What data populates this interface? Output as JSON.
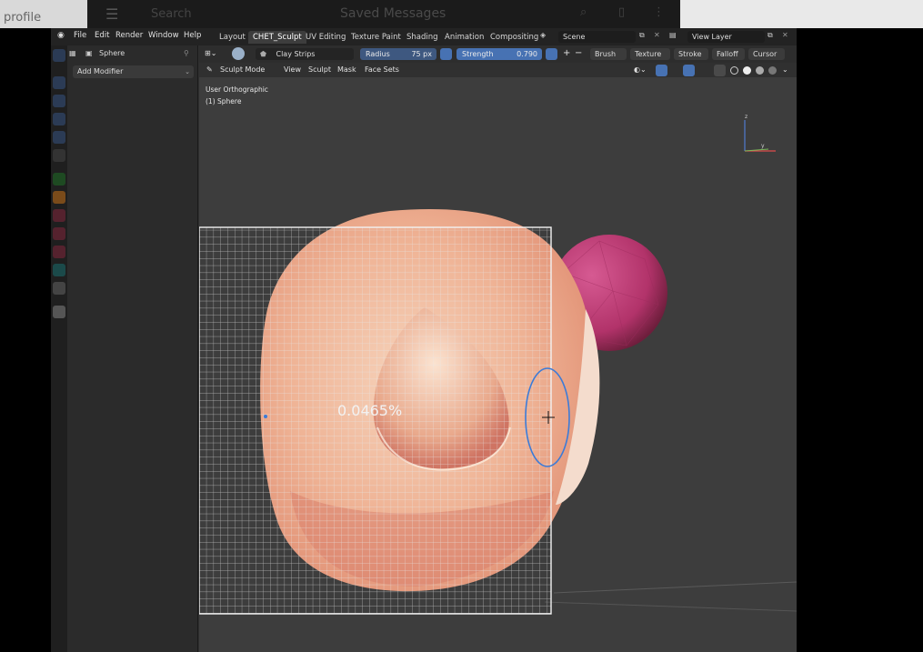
{
  "background_app": {
    "title": "Saved Messages",
    "search_label": "Search",
    "left_text": "profile"
  },
  "topbar": {
    "menus": [
      "File",
      "Edit",
      "Render",
      "Window",
      "Help"
    ],
    "workspace_tabs": [
      "Layout",
      "CHET_Sculpt",
      "UV Editing",
      "Texture Paint",
      "Shading",
      "Animation",
      "Compositing"
    ],
    "active_tab": "CHET_Sculpt",
    "scene_label": "Scene",
    "view_layer_label": "View Layer"
  },
  "properties": {
    "object_name": "Sphere",
    "add_modifier_label": "Add Modifier"
  },
  "tool_header": {
    "brush_name": "Clay Strips",
    "radius_label": "Radius",
    "radius_value": "75 px",
    "strength_label": "Strength",
    "strength_value": "0.790",
    "dropdowns": [
      "Brush",
      "Texture",
      "Stroke",
      "Falloff",
      "Cursor"
    ]
  },
  "sub_header": {
    "mode": "Sculpt Mode",
    "menus": [
      "View",
      "Sculpt",
      "Mask",
      "Face Sets"
    ]
  },
  "viewport": {
    "view_name": "User Orthographic",
    "object_label": "(1) Sphere",
    "progress_text": "0.0465%",
    "axis_labels": {
      "z": "z",
      "y": "y"
    }
  },
  "colors": {
    "accent_blue": "#4772b3",
    "active_tab": "#3d3d3d",
    "viewport_bg": "#3d3d3d",
    "mesh_skin": "#f0b89a",
    "mesh_pink": "#c43f7a"
  }
}
